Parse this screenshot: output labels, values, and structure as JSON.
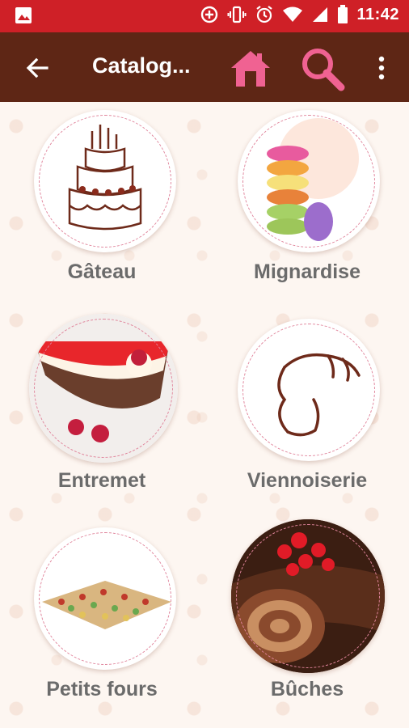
{
  "status_bar": {
    "time": "11:42",
    "icons": [
      "image-icon",
      "add-circle-icon",
      "vibrate-icon",
      "alarm-icon",
      "wifi-icon",
      "signal-icon",
      "battery-icon"
    ]
  },
  "app_bar": {
    "title": "Catalog...",
    "back_icon": "arrow-left-icon",
    "home_icon": "home-icon",
    "search_icon": "search-icon",
    "menu_icon": "more-vert-icon"
  },
  "categories": [
    {
      "label": "Gâteau",
      "image": "birthday-cake-drawing"
    },
    {
      "label": "Mignardise",
      "image": "macaron-stack-photo"
    },
    {
      "label": "Entremet",
      "image": "raspberry-cake-slice-photo"
    },
    {
      "label": "Viennoiserie",
      "image": "croissant-drawing"
    },
    {
      "label": "Petits fours",
      "image": "petits-fours-platter-photo"
    },
    {
      "label": "Bûches",
      "image": "chocolate-log-photo"
    }
  ],
  "colors": {
    "status_bar": "#cf2027",
    "app_bar": "#5e2615",
    "accent_pink": "#f06292",
    "label_gray": "#6b6b6b"
  }
}
